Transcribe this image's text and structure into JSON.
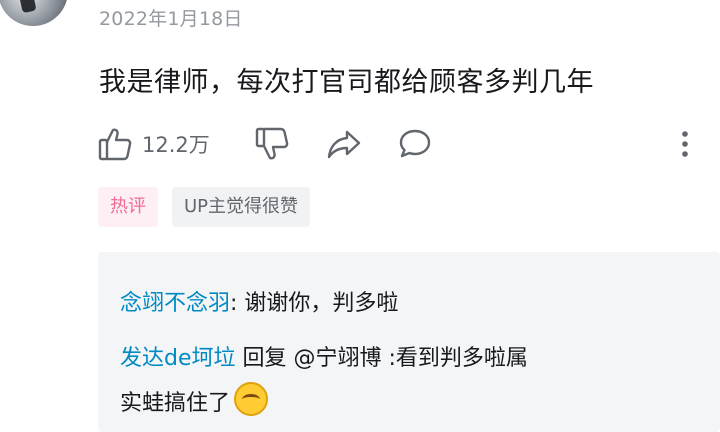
{
  "comment": {
    "date": "2022年1月18日",
    "text": "我是律师，每次打官司都给顾客多判几年",
    "like_count": "12.2万",
    "tags": {
      "hot": "热评",
      "up_liked": "UP主觉得很赞"
    }
  },
  "replies": [
    {
      "user": "念翊不念羽",
      "text": ": 谢谢你，判多啦"
    },
    {
      "user": "发达de坷垃",
      "text": " 回复 @宁翊博 :看到判多啦属"
    },
    {
      "text": "实蛙搞住了",
      "emoji": "laughing-tears-emoji"
    }
  ],
  "icons": {
    "like": "thumbs-up-icon",
    "dislike": "thumbs-down-icon",
    "share": "share-icon",
    "reply": "comment-bubble-icon",
    "more": "more-vertical-icon"
  },
  "colors": {
    "username": "#008ac5",
    "hot_tag_text": "#f06d95",
    "hot_tag_bg": "#fdeff4",
    "meta_text": "#9499a0",
    "reply_panel_bg": "#f4f5f7"
  }
}
